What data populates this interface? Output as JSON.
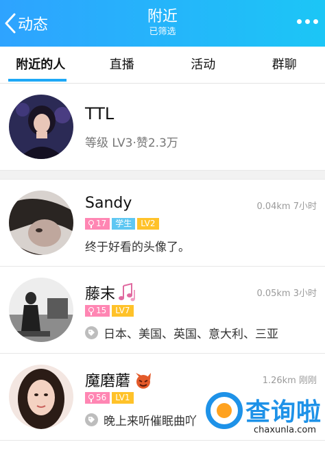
{
  "header": {
    "back_label": "动态",
    "title": "附近",
    "subtitle": "已筛选"
  },
  "tabs": [
    {
      "label": "附近的人",
      "active": true
    },
    {
      "label": "直播",
      "active": false
    },
    {
      "label": "活动",
      "active": false
    },
    {
      "label": "群聊",
      "active": false
    }
  ],
  "me": {
    "name": "TTL",
    "level_text": "等级 LV3·赞2.3万"
  },
  "people": [
    {
      "name": "Sandy",
      "distance": "0.04km",
      "time": "7小时",
      "age": "17",
      "student": "学生",
      "level": "LV2",
      "description": "终于好看的头像了。",
      "name_icon": ""
    },
    {
      "name": "藤末",
      "distance": "0.05km",
      "time": "3小时",
      "age": "15",
      "student": "",
      "level": "LV7",
      "description": "日本、美国、英国、意大利、三亚",
      "name_icon": "music-notes-icon"
    },
    {
      "name": "魔磨蘑",
      "distance": "1.26km",
      "time": "刚刚",
      "age": "56",
      "student": "",
      "level": "LV1",
      "description": "晚上来听催眠曲吖",
      "name_icon": "devil-icon"
    }
  ],
  "watermark": {
    "text": "查询啦",
    "url": "chaxunla.com"
  },
  "colors": {
    "header_start": "#2ea3ff",
    "header_end": "#1cc6f6",
    "tab_indicator": "#1ea8f6",
    "badge_age": "#ff86b3",
    "badge_student": "#5ec7f2",
    "badge_level": "#ffc229"
  }
}
